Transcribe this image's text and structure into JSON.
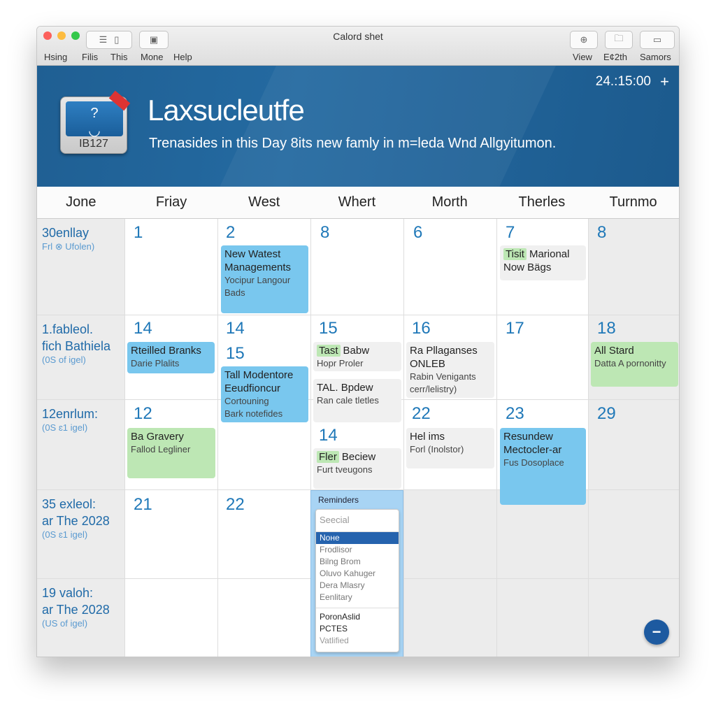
{
  "window": {
    "title": "Calord shet"
  },
  "menu": [
    "Hsing",
    "Filis",
    "This",
    "Mone",
    "Help"
  ],
  "toolbar_right": [
    "View",
    "E¢2th",
    "Samors"
  ],
  "banner": {
    "app_icon_label": "IB127",
    "title": "Laxsucleutfe",
    "subtitle": "Trenasides in this Day 8its new famly in m=leda Wnd Allgyitumon.",
    "clock": "24.:15:00",
    "plus": "+"
  },
  "days": [
    "Jone",
    "Friay",
    "West",
    "Whert",
    "Morth",
    "Therles",
    "Turnmo"
  ],
  "row_labels": [
    {
      "title": [
        "30enllay"
      ],
      "sub": "Frl ⊗ Ufolen)"
    },
    {
      "title": [
        "1.fableol.",
        "fich Bathiela"
      ],
      "sub": "(0S of igel)"
    },
    {
      "title": [
        "12enrlum:"
      ],
      "sub": "(0S ɛ1 igel)"
    },
    {
      "title": [
        "35 exleol:",
        "ar The 2028"
      ],
      "sub": "(0S ɛ1 igel)"
    },
    {
      "title": [
        "19 valoh:",
        "ar The 2028"
      ],
      "sub": "(US of igel)"
    }
  ],
  "dates": [
    "1",
    "2",
    "8",
    "6",
    "7",
    "8",
    "14",
    "14",
    "15",
    "15",
    "16",
    "17",
    "18",
    "12",
    "14",
    "22",
    "23",
    "29",
    "21",
    "22"
  ],
  "events": [
    {
      "color": "blue",
      "title": "New Watest Managements",
      "sub": [
        "Yocipur Langour",
        "Bads"
      ]
    },
    {
      "color": "gray",
      "tag": "Tisit",
      "title": "Marional",
      "sub2": "Now Bägs"
    },
    {
      "color": "blue",
      "title": "Rteilled Branks",
      "sub": [
        "Darie Plalits"
      ]
    },
    {
      "color": "blue",
      "title": "Tall Modentore Eeudfioncur",
      "sub": [
        "Cortouning",
        "Bark notefides"
      ]
    },
    {
      "color": "gray",
      "tag": "Tast",
      "title": "Babw",
      "sub": [
        "Hopr Proler"
      ]
    },
    {
      "color": "gray",
      "title": "TAL. Bpdew",
      "sub": [
        "Ran cale tletles"
      ]
    },
    {
      "color": "gray",
      "title": "Ra Pllaganses ONLEB",
      "sub": [
        "Rabin Venigants",
        "cerr/lelistry)"
      ]
    },
    {
      "color": "green",
      "title": "All Stard",
      "sub": [
        "Datta A pornonitty"
      ]
    },
    {
      "color": "green",
      "title": "Ba Gravery",
      "sub": [
        "Fallod Legliner"
      ]
    },
    {
      "color": "gray",
      "tag": "Fler",
      "title": "Beciew",
      "sub": [
        "Furt tveugons"
      ]
    },
    {
      "color": "gray",
      "title": "Hel ims",
      "sub": [
        "Forl (Inolstor)"
      ]
    },
    {
      "color": "blue",
      "title": "Resundew Mectocler-ar",
      "sub": [
        "Fus Dosoplace"
      ]
    }
  ],
  "reminders": {
    "header": "Reminders",
    "search_placeholder": "Seecial",
    "items": [
      "Noне",
      "Frodlisor",
      "Bilng Brom",
      "Oluvo Kahuger",
      "Dera Mlasry",
      "Eenlitary"
    ],
    "selected": "Noне",
    "footer_items": [
      "PoronAslid",
      "PCTES",
      "Vatlified"
    ]
  },
  "fab_icon": "minus-icon",
  "colors": {
    "accent": "#1f78b8",
    "banner": "#1f5f93",
    "event_blue": "#79c7ee",
    "event_green": "#bde7b4",
    "selected": "#2563ae"
  }
}
